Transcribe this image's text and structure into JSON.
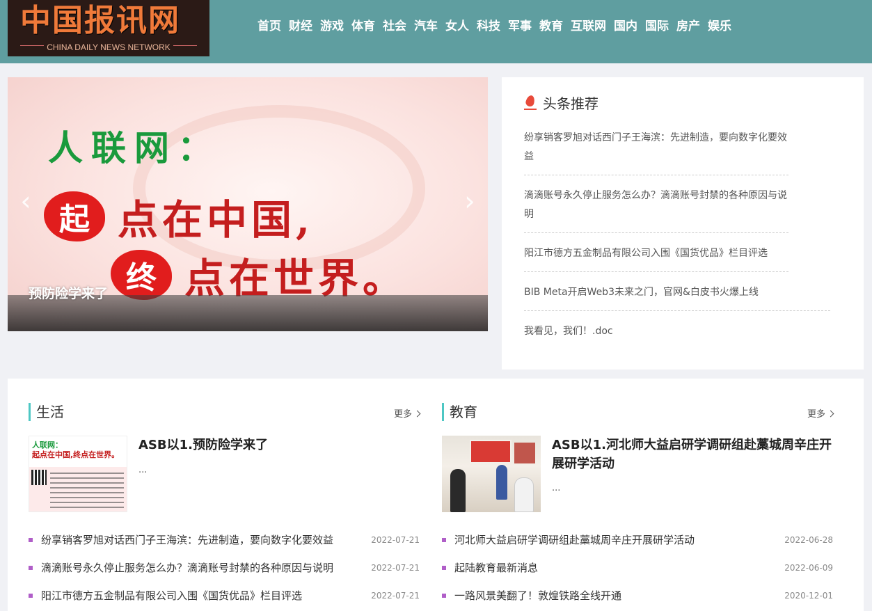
{
  "header": {
    "logo_text": "中国报讯网",
    "logo_sub": "CHINA DAILY NEWS NETWORK",
    "nav": [
      "首页",
      "财经",
      "游戏",
      "体育",
      "社会",
      "汽车",
      "女人",
      "科技",
      "军事",
      "教育",
      "互联网",
      "国内",
      "国际",
      "房产",
      "娱乐"
    ]
  },
  "slider": {
    "line1": "人联网：",
    "row2_char": "起",
    "row2_text": "点在中国,",
    "row3_char": "终",
    "row3_text": "点在世界。",
    "caption": "预防险学来了",
    "prev_glyph": "‹",
    "next_glyph": "›"
  },
  "headlines": {
    "title": "头条推荐",
    "items": [
      "纷享销客罗旭对话西门子王海滨：先进制造，要向数字化要效益",
      "滴滴账号永久停止服务怎么办？滴滴账号封禁的各种原因与说明",
      "阳江市德方五金制品有限公司入围《国货优品》栏目评选",
      "BIB Meta开启Web3未来之门，官网&白皮书火爆上线",
      "我看见，我们！.doc"
    ]
  },
  "sections": [
    {
      "title": "生活",
      "more": "更多",
      "featured_title": "ASB以1.预防险学来了",
      "featured_excerpt": "...",
      "img_line1": "人联网：",
      "img_line2": "起点在中国,终点在世界。",
      "items": [
        {
          "title": "纷享销客罗旭对话西门子王海滨：先进制造，要向数字化要效益",
          "date": "2022-07-21"
        },
        {
          "title": "滴滴账号永久停止服务怎么办？滴滴账号封禁的各种原因与说明",
          "date": "2022-07-21"
        },
        {
          "title": "阳江市德方五金制品有限公司入围《国货优品》栏目评选",
          "date": "2022-07-21"
        }
      ]
    },
    {
      "title": "教育",
      "more": "更多",
      "featured_title": "ASB以1.河北师大益启研学调研组赴藁城周辛庄开展研学活动",
      "featured_excerpt": "...",
      "items": [
        {
          "title": "河北师大益启研学调研组赴藁城周辛庄开展研学活动",
          "date": "2022-06-28"
        },
        {
          "title": "起陆教育最新消息",
          "date": "2022-06-09"
        },
        {
          "title": "一路风景美翻了！敦煌铁路全线开通",
          "date": "2020-12-01"
        }
      ]
    }
  ]
}
